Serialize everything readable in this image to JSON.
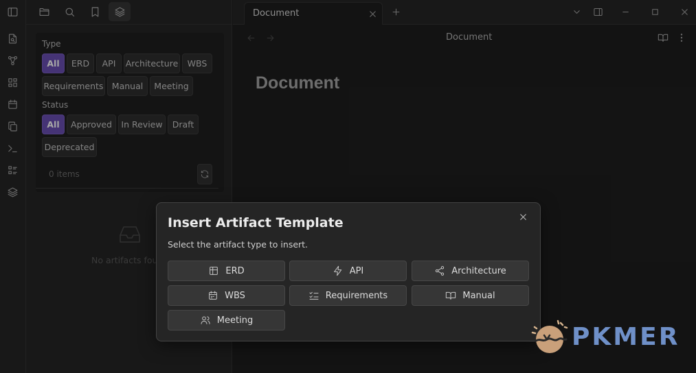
{
  "ribbon": {
    "icons": [
      "file-search-icon",
      "graph-icon",
      "layout-grid-icon",
      "calendar-icon",
      "copy-icon",
      "terminal-icon",
      "list-icon",
      "layers-icon"
    ]
  },
  "sidebar": {
    "tab_icons": [
      "sidebar-toggle-icon",
      "folder-icon",
      "search-icon",
      "bookmark-icon",
      "layers-icon"
    ],
    "active_tab": "layers-icon",
    "filters": {
      "type_label": "Type",
      "type_options": [
        "All",
        "ERD",
        "API",
        "Architecture",
        "WBS",
        "Requirements",
        "Manual",
        "Meeting"
      ],
      "type_selected": "All",
      "status_label": "Status",
      "status_options": [
        "All",
        "Approved",
        "In Review",
        "Draft",
        "Deprecated"
      ],
      "status_selected": "All",
      "item_count": "0 items"
    },
    "empty_state": "No artifacts fou"
  },
  "tabbar": {
    "tab_title": "Document"
  },
  "view": {
    "title": "Document",
    "heading": "Document"
  },
  "modal": {
    "title": "Insert Artifact Template",
    "description": "Select the artifact type to insert.",
    "buttons": [
      {
        "label": "ERD",
        "icon": "table-icon"
      },
      {
        "label": "API",
        "icon": "zap-icon"
      },
      {
        "label": "Architecture",
        "icon": "share-nodes-icon"
      },
      {
        "label": "WBS",
        "icon": "calendar-icon"
      },
      {
        "label": "Requirements",
        "icon": "checklist-icon"
      },
      {
        "label": "Manual",
        "icon": "book-open-icon"
      },
      {
        "label": "Meeting",
        "icon": "users-icon"
      }
    ]
  },
  "watermark": {
    "text": "PKMER"
  },
  "colors": {
    "accent": "#6a4fb4",
    "background": "#1e1e1e",
    "watermark": "#6f90c8"
  }
}
